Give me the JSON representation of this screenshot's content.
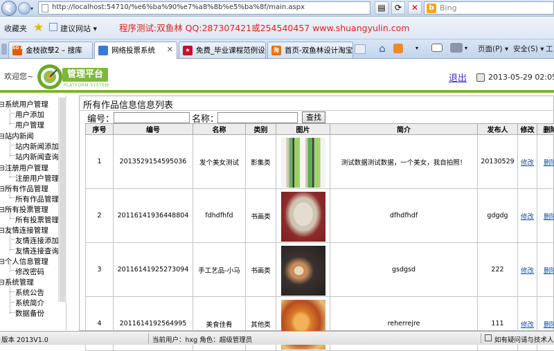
{
  "browser": {
    "url": "http://localhost:54710/%e6%ba%90%e7%a8%8b%e5%ba%8f/main.aspx",
    "search_placeholder": "Bing",
    "favorites_label": "收藏夹",
    "suggested_sites_label": "建议网站 ▾",
    "banner": "程序测试:双鱼林 QQ:287307421或254540457 www.shuangyulin.com",
    "tabs": [
      {
        "label": "金枝欲孽2 – 搜库",
        "icon": "SO KU",
        "active": false
      },
      {
        "label": "网络投票系统",
        "icon": "",
        "active": true
      },
      {
        "label": "免费_毕业课程范例设计...",
        "icon": "",
        "active": false
      },
      {
        "label": "首页-双鱼林设计淘宝店...",
        "icon": "",
        "active": false
      }
    ],
    "commands": {
      "page": "页面(P) ▾",
      "safety": "安全(S) ▾",
      "tools": "工"
    }
  },
  "header": {
    "welcome": "欢迎您~",
    "platform": "管理平台",
    "platform_sub": "PLATFORM SYSTEM",
    "logout": "退出",
    "datetime": "2013-05-29 02:05:1"
  },
  "sidebar": {
    "groups": [
      {
        "label": "系统用户管理",
        "items": [
          "用户添加",
          "用户管理"
        ]
      },
      {
        "label": "站内新闻",
        "items": [
          "站内新闻添加",
          "站内新闻查询"
        ]
      },
      {
        "label": "注册用户管理",
        "items": [
          "注册用户管理"
        ]
      },
      {
        "label": "所有作品管理",
        "items": [
          "所有作品管理"
        ]
      },
      {
        "label": "所有投票管理",
        "items": [
          "所有投票管理"
        ]
      },
      {
        "label": "友情连接管理",
        "items": [
          "友情连接添加",
          "友情连接查询"
        ]
      },
      {
        "label": "个人信息管理",
        "items": [
          "修改密码"
        ]
      },
      {
        "label": "系统管理",
        "items": [
          "系统公告",
          "系统简介",
          "数据备份"
        ]
      }
    ]
  },
  "main": {
    "title": "所有作品信息信息列表",
    "search": {
      "code_label": "编号：",
      "name_label": "名称：",
      "button": "查找"
    },
    "columns": [
      "序号",
      "编号",
      "名称",
      "类别",
      "图片",
      "简介",
      "发布人",
      "修改",
      "删除"
    ],
    "rows": [
      {
        "seq": "1",
        "code": "2013529154595036",
        "name": "发个美女测试",
        "category": "影集类",
        "image": "photo-two-women",
        "intro": "测试数据测试数据，一个美女，我自拍照！",
        "publisher": "20130529",
        "edit": "修改",
        "del": "删除"
      },
      {
        "seq": "2",
        "code": "20116141936448804",
        "name": "fdhdfhfd",
        "category": "书画类",
        "image": "photo-deer-sculpture",
        "intro": "dfhdfhdf",
        "publisher": "gdgdg",
        "edit": "修改",
        "del": "删除"
      },
      {
        "seq": "3",
        "code": "20116141925273094",
        "name": "手工艺品-小马",
        "category": "书画类",
        "image": "photo-handicraft-horses",
        "intro": "gsdgsd",
        "publisher": "222",
        "edit": "修改",
        "del": "删除"
      },
      {
        "seq": "4",
        "code": "2011614192564995",
        "name": "美食佳肴",
        "category": "其他类",
        "image": "photo-fried-food",
        "intro": "reherrejre",
        "publisher": "111",
        "edit": "修改",
        "del": "删除"
      }
    ]
  },
  "status": {
    "version": "版本 2013V1.0",
    "current_user": "当前用户：hxg  角色：超级管理员",
    "help": "如有疑问请与技术人员"
  }
}
